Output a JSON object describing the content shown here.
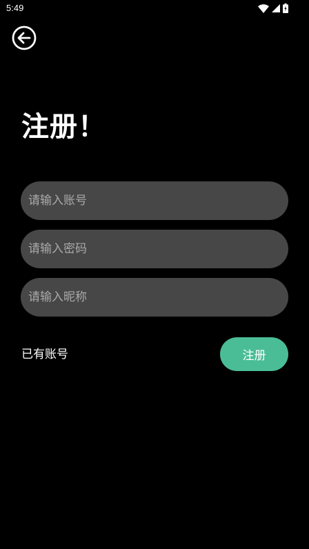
{
  "status_bar": {
    "time": "5:49",
    "icons": [
      "wifi-icon",
      "cellular-signal-icon",
      "battery-icon"
    ]
  },
  "header": {
    "back_icon": "back-arrow-circle-icon"
  },
  "main": {
    "title": "注册！",
    "account_input": {
      "placeholder": "请输入账号",
      "value": ""
    },
    "password_input": {
      "placeholder": "请输入密码",
      "value": ""
    },
    "nickname_input": {
      "placeholder": "请输入昵称",
      "value": ""
    },
    "have_account_label": "已有账号",
    "register_label": "注册"
  },
  "colors": {
    "background": "#000000",
    "input_background": "#474747",
    "placeholder": "#a9a9a9",
    "accent": "#4abd97",
    "text": "#ffffff"
  }
}
